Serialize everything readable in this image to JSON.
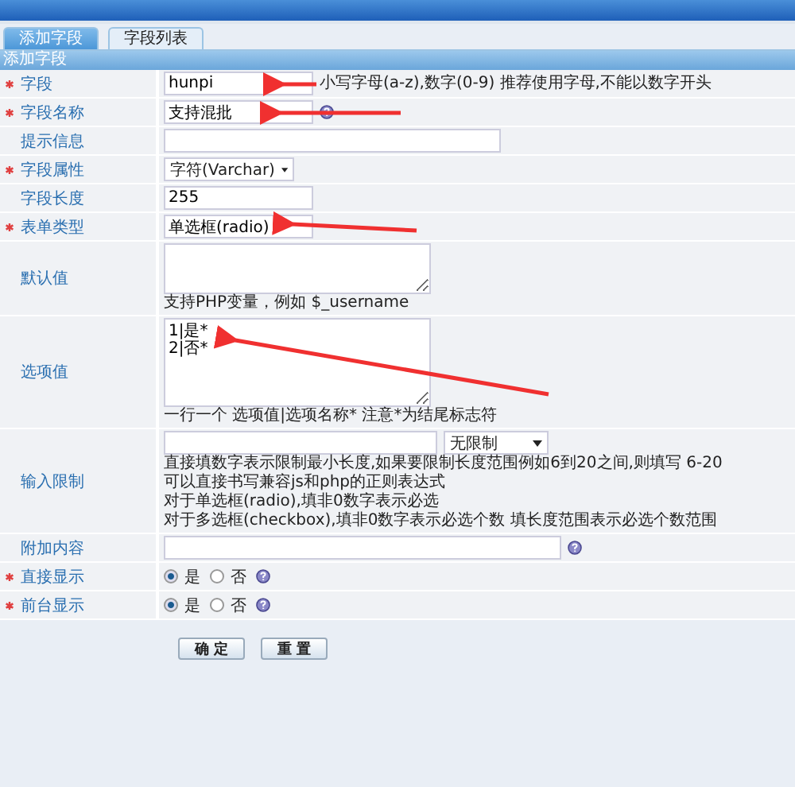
{
  "tabs": [
    {
      "label": "添加字段",
      "selected": true
    },
    {
      "label": "字段列表",
      "selected": false
    }
  ],
  "section_title": "添加字段",
  "fields": [
    {
      "kind": "text",
      "label": "字段",
      "required": true,
      "value": "hunpi",
      "hints": [
        "小写字母(a-z),数字(0-9) 推荐使用字母,不能以数字开头"
      ],
      "help": false
    },
    {
      "kind": "text",
      "label": "字段名称",
      "required": true,
      "value": "支持混批",
      "help": true
    },
    {
      "kind": "text",
      "label": "提示信息",
      "required": false,
      "help": false
    },
    {
      "kind": "select",
      "label": "字段属性",
      "required": true,
      "value": "字符(Varchar)",
      "help": false
    },
    {
      "kind": "text",
      "label": "字段长度",
      "required": false,
      "value": "255",
      "help": false
    },
    {
      "kind": "text",
      "label": "表单类型",
      "required": true,
      "value": "单选框(radio)",
      "help": false
    },
    {
      "kind": "textarea",
      "label": "默认值",
      "required": false,
      "hints": [
        "支持PHP变量，例如 $_username"
      ],
      "help": false
    },
    {
      "kind": "textarea",
      "label": "选项值",
      "required": false,
      "value": "1|是*\n2|否*",
      "hints": [
        "一行一个 选项值|选项名称* 注意*为结尾标志符"
      ],
      "help": false
    },
    {
      "kind": "limit",
      "label": "输入限制",
      "required": false,
      "select": "无限制",
      "hints": [
        "直接填数字表示限制最小长度,如果要限制长度范围例如6到20之间,则填写 6-20",
        "可以直接书写兼容js和php的正则表达式",
        "对于单选框(radio),填非0数字表示必选",
        "对于多选框(checkbox),填非0数字表示必选个数 填长度范围表示必选个数范围"
      ],
      "help": false
    },
    {
      "kind": "text",
      "label": "附加内容",
      "required": false,
      "help": true
    },
    {
      "kind": "radio",
      "label": "直接显示",
      "required": true,
      "options": [
        {
          "label": "是",
          "selected": true
        },
        {
          "label": "否",
          "selected": false
        }
      ],
      "help": true
    },
    {
      "kind": "radio",
      "label": "前台显示",
      "required": true,
      "options": [
        {
          "label": "是",
          "selected": true
        },
        {
          "label": "否",
          "selected": false
        }
      ],
      "help": true
    }
  ],
  "buttons": [
    "确 定",
    "重 置"
  ]
}
